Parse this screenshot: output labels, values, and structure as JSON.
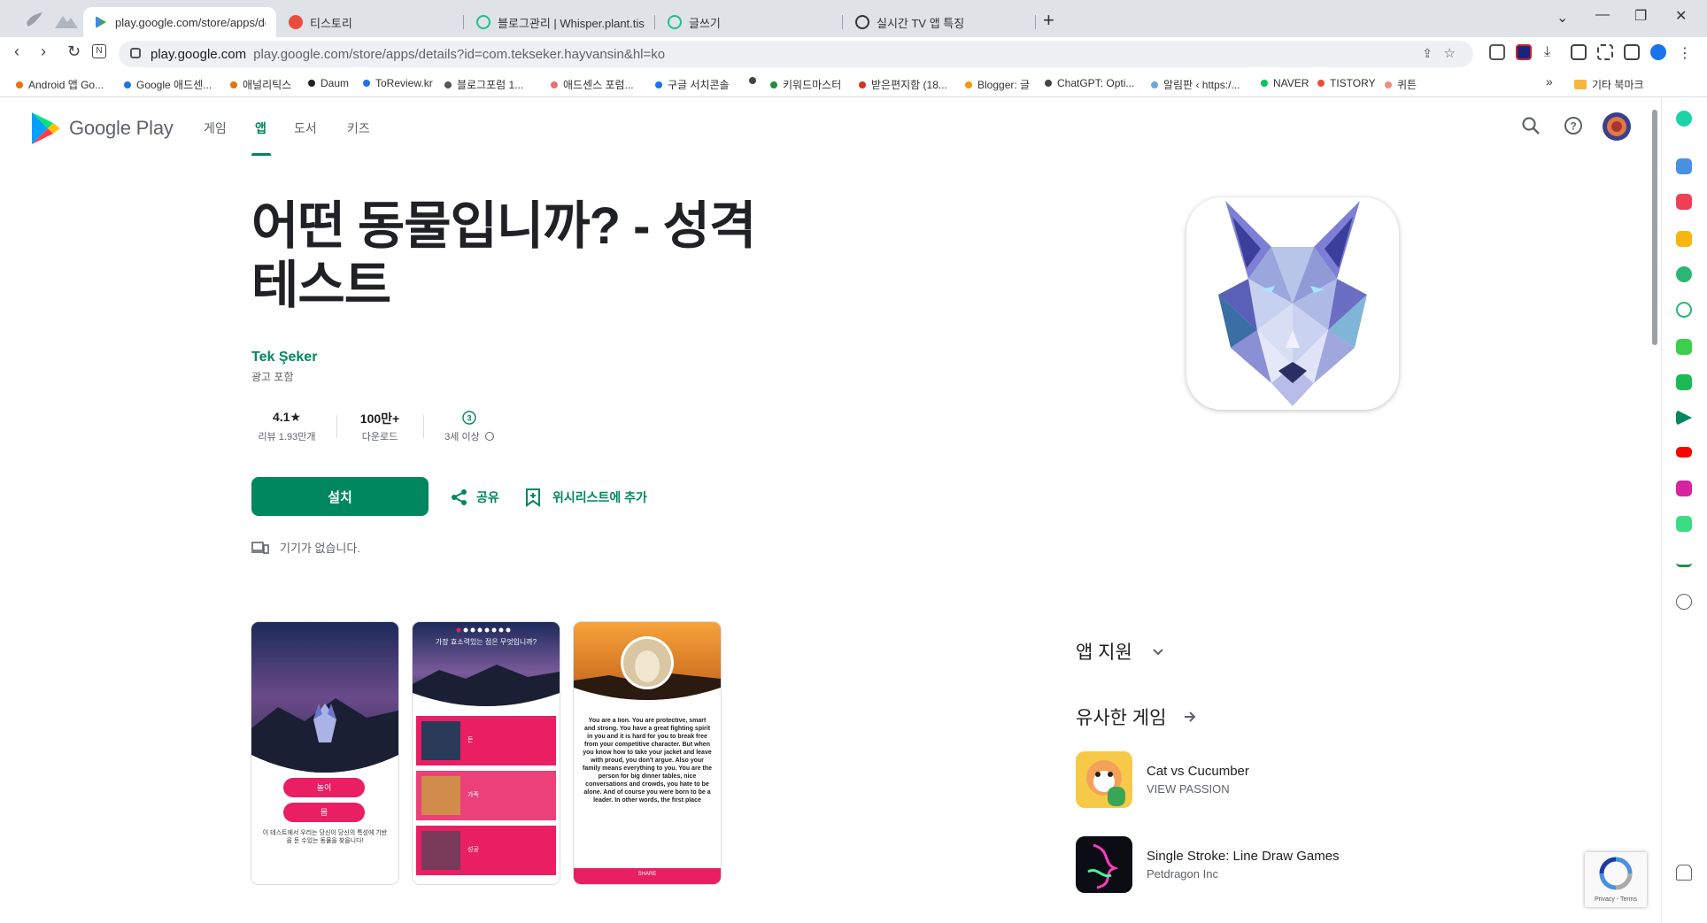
{
  "browser": {
    "tabs": [
      {
        "title": "play.google.com/store/apps/det",
        "active": true,
        "fav_color": "#34a853"
      },
      {
        "title": "티스토리",
        "active": false,
        "fav_color": "#eb4d3d"
      },
      {
        "title": "블로그관리 | Whisper.plant.tistor",
        "active": false,
        "fav_color": "#1fbf8f"
      },
      {
        "title": "글쓰기",
        "active": false,
        "fav_color": "#1fbf8f"
      },
      {
        "title": "실시간 TV 앱 특징",
        "active": false,
        "fav_color": "#333333"
      }
    ],
    "new_tab": "+",
    "url_host": "play.google.com",
    "url_path": "play.google.com/store/apps/details?id=com.tekseker.hayvansin&hl=ko",
    "bookmarks": [
      {
        "label": "Android 앱 Go...",
        "color": "#e8710a"
      },
      {
        "label": "Google 애드센...",
        "color": "#1a73e8"
      },
      {
        "label": "애널리틱스",
        "color": "#e8710a"
      },
      {
        "label": "Daum",
        "color": "#202124"
      },
      {
        "label": "ToReview.kr",
        "color": "#1a73e8"
      },
      {
        "label": "블로그포럼 1...",
        "color": "#555555"
      },
      {
        "label": "애드센스 포럼...",
        "color": "#e57373"
      },
      {
        "label": "구글 서치콘솔",
        "color": "#1a73e8"
      },
      {
        "label": "",
        "color": "#444444"
      },
      {
        "label": "키워드마스터",
        "color": "#1e8e3e"
      },
      {
        "label": "받은편지함 (18...",
        "color": "#d93025"
      },
      {
        "label": "Blogger: 글",
        "color": "#f29900"
      },
      {
        "label": "ChatGPT: Opti...",
        "color": "#444444"
      },
      {
        "label": "알림판 ‹ https:/...",
        "color": "#6fa8dc"
      },
      {
        "label": "NAVER",
        "color": "#03c75a"
      },
      {
        "label": "TISTORY",
        "color": "#eb4d3d"
      },
      {
        "label": "퀴튼",
        "color": "#f28b82"
      }
    ],
    "bookmarks_more": "»",
    "other_bookmarks": "기타 북마크"
  },
  "store": {
    "brand": "Google Play",
    "nav": [
      "게임",
      "앱",
      "도서",
      "키즈"
    ],
    "active_nav": "앱"
  },
  "app": {
    "title_line1": "어떤 동물입니까? - 성격",
    "title_line2": "테스트",
    "developer": "Tek Şeker",
    "ads_note": "광고 포함",
    "rating_value": "4.1★",
    "rating_label": "리뷰 1.93만개",
    "downloads_value": "100만+",
    "downloads_label": "다운로드",
    "age_badge": "3",
    "age_label": "3세 이상",
    "install_label": "설치",
    "share_label": "공유",
    "wishlist_label": "위시리스트에 추가",
    "no_device": "기기가 없습니다."
  },
  "screenshots": {
    "shot1": {
      "btn1": "놀이",
      "btn2": "몸",
      "caption": "이 테스트에서 우리는 당신이 당신의 특성에 기반을 둔 수있는 동물을 찾을니다!"
    },
    "shot2": {
      "question": "가장 효소력있는 점은 무엇입니까?",
      "options": [
        "돈",
        "가족",
        "성공"
      ]
    },
    "shot3": {
      "result": "You are a lion. You are protective, smart and strong. You have a great fighting spirit in you and it is hard for you to break free from your competitive character. But when you know how to take your jacket and leave with proud, you don't argue. Also your family means everything to you. You are the person for big dinner tables, nice conversations and crowds, you hate to be alone. And of course you were born to be a leader. In other words, the first place",
      "share": "SHARE"
    }
  },
  "sidebar": {
    "app_support": "앱 지원",
    "similar_title": "유사한 게임",
    "similar": [
      {
        "name": "Cat vs Cucumber",
        "publisher": "VIEW PASSION"
      },
      {
        "name": "Single Stroke: Line Draw Games",
        "publisher": "Petdragon Inc"
      }
    ]
  },
  "recaptcha": {
    "links": "Privacy - Terms"
  },
  "colors": {
    "accent": "#01875f",
    "pink": "#e91e63"
  }
}
